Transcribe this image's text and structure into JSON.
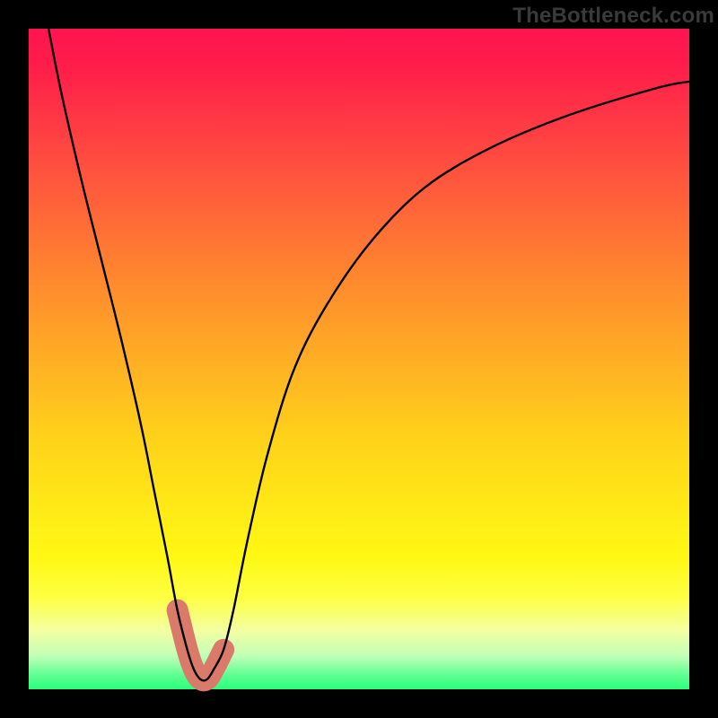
{
  "watermark": "TheBottleneck.com",
  "chart_data": {
    "type": "line",
    "title": "",
    "xlabel": "",
    "ylabel": "",
    "xlim": [
      0,
      100
    ],
    "ylim": [
      0,
      100
    ],
    "grid": false,
    "series": [
      {
        "name": "curve",
        "x": [
          3,
          5,
          8,
          11,
          14,
          17,
          19,
          21,
          22.5,
          24,
          25,
          26,
          27,
          28,
          29.5,
          31,
          33,
          36,
          40,
          45,
          52,
          60,
          70,
          82,
          95,
          100
        ],
        "y": [
          100,
          90,
          77,
          65,
          53,
          40,
          30,
          20,
          12,
          6,
          3,
          1.5,
          1.5,
          3,
          6,
          12,
          22,
          35,
          48,
          58,
          68,
          76,
          82,
          87,
          91,
          92
        ]
      }
    ],
    "marker_region": {
      "comment": "coral rounded segment near minimum",
      "x": [
        22.5,
        29.5
      ],
      "y_approx": 3
    },
    "colors": {
      "curve": "#000000",
      "marker": "#d97a6b",
      "gradient_top": "#ff1450",
      "gradient_bottom": "#28ff7a"
    }
  }
}
